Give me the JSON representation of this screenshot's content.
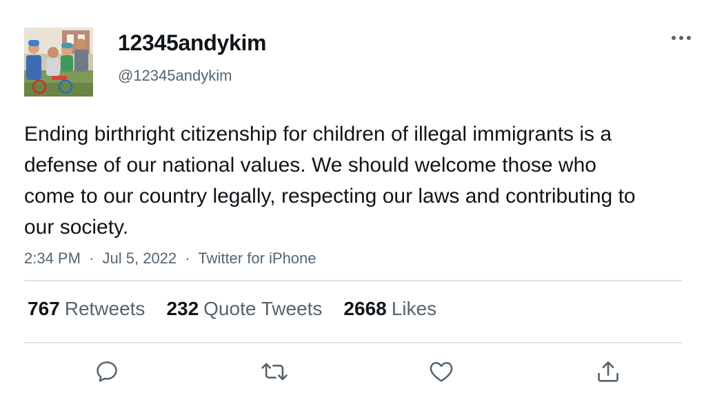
{
  "tweet": {
    "author": {
      "display_name": "12345andykim",
      "handle": "@12345andykim"
    },
    "text": "Ending birthright citizenship for children of illegal immigrants is a defense of our national values. We should welcome those who come to our country legally, respecting our laws and contributing to our society.",
    "time": "2:34 PM",
    "date": "Jul 5, 2022",
    "separator": "·",
    "source": "Twitter for iPhone"
  },
  "stats": {
    "retweets": {
      "count": "767",
      "label": "Retweets"
    },
    "quote_tweets": {
      "count": "232",
      "label": "Quote Tweets"
    },
    "likes": {
      "count": "2668",
      "label": "Likes"
    }
  },
  "icons": {
    "more": "more-horizontal-icon",
    "reply": "reply-icon",
    "retweet": "retweet-icon",
    "like": "heart-icon",
    "share": "share-icon"
  },
  "colors": {
    "text_primary": "#0f1419",
    "text_secondary": "#536471",
    "divider": "#e1e4e7",
    "icon": "#536471"
  }
}
